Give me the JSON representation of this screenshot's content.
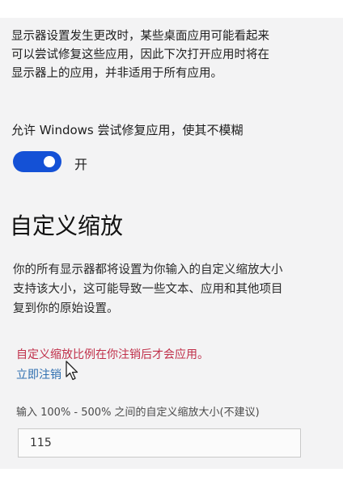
{
  "intro": {
    "lines": [
      "显示器设置发生更改时，某些桌面应用可能看起来",
      "可以尝试修复这些应用，因此下次打开应用时将在",
      "显示器上的应用，并非适用于所有应用。"
    ]
  },
  "fix_apps": {
    "label": "允许 Windows 尝试修复应用，使其不模糊",
    "toggle_state": "开",
    "toggle_on": true
  },
  "custom_scaling": {
    "title": "自定义缩放",
    "description_lines": [
      "你的所有显示器都将设置为你输入的自定义缩放大小",
      "支持该大小，这可能导致一些文本、应用和其他项目",
      "复到你的原始设置。"
    ],
    "warning": "自定义缩放比例在你注销后才会应用。",
    "signout_link": "立即注销",
    "input_label": "输入 100% - 500% 之间的自定义缩放大小(不建议)",
    "input_value": "115"
  },
  "colors": {
    "accent": "#1451d6",
    "warning": "#c0304a",
    "link": "#2f6fb0"
  },
  "icons": {
    "cursor": "mouse-pointer-icon"
  }
}
